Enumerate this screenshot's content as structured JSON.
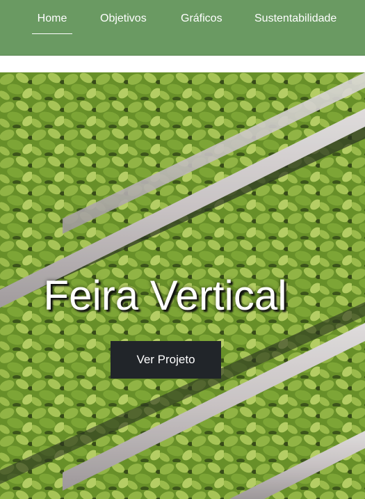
{
  "nav": {
    "items": [
      {
        "label": "Home",
        "active": true
      },
      {
        "label": "Objetivos",
        "active": false
      },
      {
        "label": "Gráficos",
        "active": false
      },
      {
        "label": "Sustentabilidade",
        "active": false
      }
    ]
  },
  "hero": {
    "title": "Feira Vertical",
    "button_label": "Ver Projeto"
  },
  "colors": {
    "nav_background": "#6a9a62",
    "button_background": "#212529",
    "foliage": "#7aa832",
    "rail": "#d8d2d4"
  }
}
